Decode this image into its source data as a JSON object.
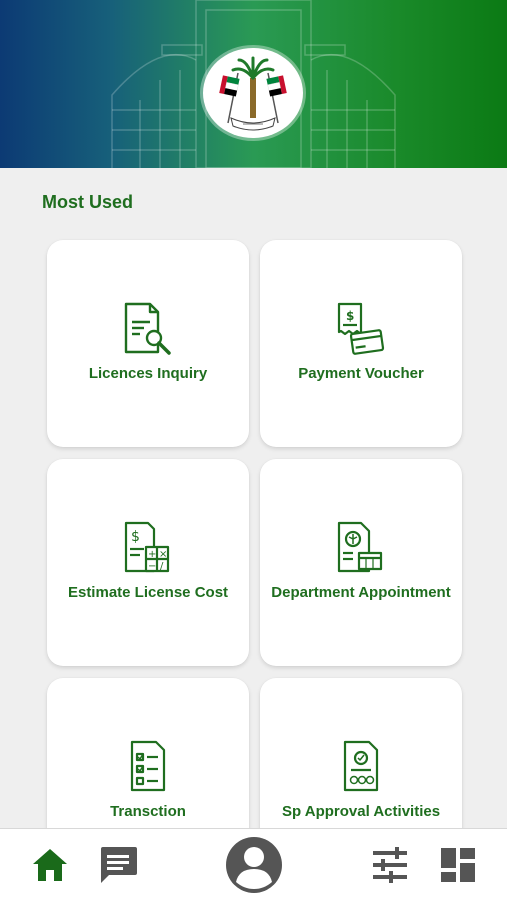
{
  "header": {
    "emblem_icon": "uae-government-emblem-icon",
    "background_icon": "building-outline-icon",
    "gradient_colors": [
      "#0c3a74",
      "#2a9a54",
      "#0b7a14"
    ]
  },
  "most_used": {
    "title": "Most Used",
    "cards": [
      {
        "label": "Licences Inquiry",
        "icon": "document-search-icon"
      },
      {
        "label": "Payment Voucher",
        "icon": "receipt-card-icon"
      },
      {
        "label": "Estimate License Cost",
        "icon": "document-calculator-icon"
      },
      {
        "label": "Department Appointment",
        "icon": "document-calendar-icon"
      },
      {
        "label": "Transction",
        "icon": "checklist-document-icon"
      },
      {
        "label": "Sp Approval Activities",
        "icon": "approval-document-icon"
      }
    ]
  },
  "bottom_nav": {
    "items": [
      {
        "icon": "home-icon",
        "active": true
      },
      {
        "icon": "chat-icon"
      },
      {
        "icon": "profile-icon"
      },
      {
        "icon": "settings-sliders-icon"
      },
      {
        "icon": "dashboard-icon"
      }
    ]
  },
  "colors": {
    "primary_green": "#1f6e1f",
    "background": "#efefef",
    "card": "#ffffff",
    "nav_icon": "#555555"
  }
}
